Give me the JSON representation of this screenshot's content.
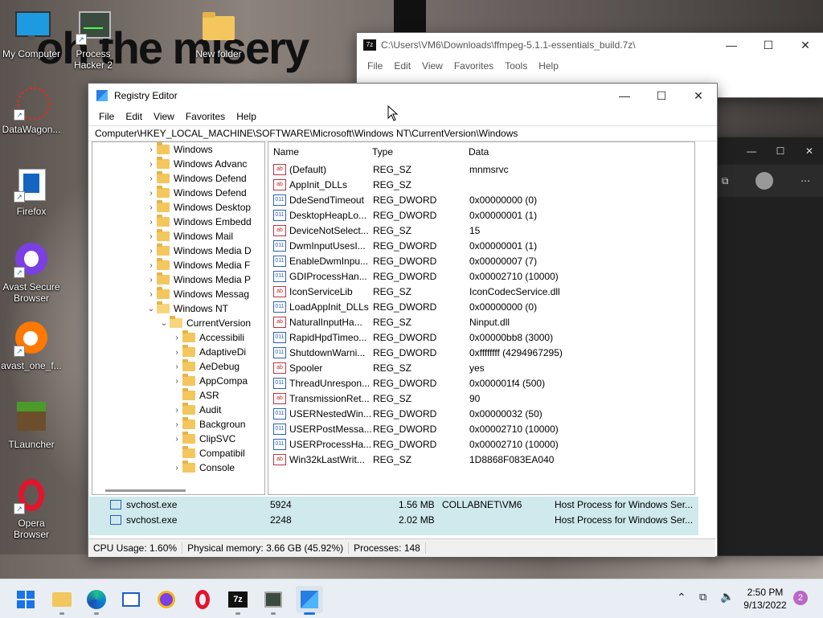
{
  "desktop": {
    "meme_text": "oh the misery",
    "icons": [
      {
        "label": "My Computer"
      },
      {
        "label": "Process\nHacker 2"
      },
      {
        "label": "New folder"
      },
      {
        "label": "DataWagon..."
      },
      {
        "label": "Firefox"
      },
      {
        "label": "Avast Secure\nBrowser"
      },
      {
        "label": "avast_one_f..."
      },
      {
        "label": "TLauncher"
      },
      {
        "label": "Opera\nBrowser"
      }
    ]
  },
  "sevenzip": {
    "title": "C:\\Users\\VM6\\Downloads\\ffmpeg-5.1.1-essentials_build.7z\\",
    "menu": [
      "File",
      "Edit",
      "View",
      "Favorites",
      "Tools",
      "Help"
    ]
  },
  "registry": {
    "title": "Registry Editor",
    "menu": [
      "File",
      "Edit",
      "View",
      "Favorites",
      "Help"
    ],
    "address": "Computer\\HKEY_LOCAL_MACHINE\\SOFTWARE\\Microsoft\\Windows NT\\CurrentVersion\\Windows",
    "tree": [
      {
        "label": "Windows",
        "depth": 0,
        "twist": "›"
      },
      {
        "label": "Windows Advanc",
        "depth": 0,
        "twist": "›"
      },
      {
        "label": "Windows Defend",
        "depth": 0,
        "twist": "›"
      },
      {
        "label": "Windows Defend",
        "depth": 0,
        "twist": "›"
      },
      {
        "label": "Windows Desktop",
        "depth": 0,
        "twist": "›"
      },
      {
        "label": "Windows Embedd",
        "depth": 0,
        "twist": "›"
      },
      {
        "label": "Windows Mail",
        "depth": 0,
        "twist": "›"
      },
      {
        "label": "Windows Media D",
        "depth": 0,
        "twist": "›"
      },
      {
        "label": "Windows Media F",
        "depth": 0,
        "twist": "›"
      },
      {
        "label": "Windows Media P",
        "depth": 0,
        "twist": "›"
      },
      {
        "label": "Windows Messag",
        "depth": 0,
        "twist": "›"
      },
      {
        "label": "Windows NT",
        "depth": 0,
        "twist": "⌄"
      },
      {
        "label": "CurrentVersion",
        "depth": 1,
        "twist": "⌄"
      },
      {
        "label": "Accessibili",
        "depth": 2,
        "twist": "›"
      },
      {
        "label": "AdaptiveDi",
        "depth": 2,
        "twist": "›"
      },
      {
        "label": "AeDebug",
        "depth": 2,
        "twist": "›"
      },
      {
        "label": "AppCompa",
        "depth": 2,
        "twist": "›"
      },
      {
        "label": "ASR",
        "depth": 2,
        "twist": ""
      },
      {
        "label": "Audit",
        "depth": 2,
        "twist": "›"
      },
      {
        "label": "Backgroun",
        "depth": 2,
        "twist": "›"
      },
      {
        "label": "ClipSVC",
        "depth": 2,
        "twist": "›"
      },
      {
        "label": "Compatibil",
        "depth": 2,
        "twist": ""
      },
      {
        "label": "Console",
        "depth": 2,
        "twist": "›"
      }
    ],
    "columns": {
      "name": "Name",
      "type": "Type",
      "data": "Data"
    },
    "values": [
      {
        "icon": "ab",
        "name": "(Default)",
        "type": "REG_SZ",
        "data": "mnmsrvc"
      },
      {
        "icon": "ab",
        "name": "AppInit_DLLs",
        "type": "REG_SZ",
        "data": ""
      },
      {
        "icon": "dw",
        "name": "DdeSendTimeout",
        "type": "REG_DWORD",
        "data": "0x00000000 (0)"
      },
      {
        "icon": "dw",
        "name": "DesktopHeapLo...",
        "type": "REG_DWORD",
        "data": "0x00000001 (1)"
      },
      {
        "icon": "ab",
        "name": "DeviceNotSelect...",
        "type": "REG_SZ",
        "data": "15"
      },
      {
        "icon": "dw",
        "name": "DwmInputUsesI...",
        "type": "REG_DWORD",
        "data": "0x00000001 (1)"
      },
      {
        "icon": "dw",
        "name": "EnableDwmInpu...",
        "type": "REG_DWORD",
        "data": "0x00000007 (7)"
      },
      {
        "icon": "dw",
        "name": "GDIProcessHan...",
        "type": "REG_DWORD",
        "data": "0x00002710 (10000)"
      },
      {
        "icon": "ab",
        "name": "IconServiceLib",
        "type": "REG_SZ",
        "data": "IconCodecService.dll"
      },
      {
        "icon": "dw",
        "name": "LoadAppInit_DLLs",
        "type": "REG_DWORD",
        "data": "0x00000000 (0)"
      },
      {
        "icon": "ab",
        "name": "NaturalInputHa...",
        "type": "REG_SZ",
        "data": "Ninput.dll"
      },
      {
        "icon": "dw",
        "name": "RapidHpdTimeo...",
        "type": "REG_DWORD",
        "data": "0x00000bb8 (3000)"
      },
      {
        "icon": "dw",
        "name": "ShutdownWarni...",
        "type": "REG_DWORD",
        "data": "0xffffffff (4294967295)"
      },
      {
        "icon": "ab",
        "name": "Spooler",
        "type": "REG_SZ",
        "data": "yes"
      },
      {
        "icon": "dw",
        "name": "ThreadUnrespon...",
        "type": "REG_DWORD",
        "data": "0x000001f4 (500)"
      },
      {
        "icon": "ab",
        "name": "TransmissionRet...",
        "type": "REG_SZ",
        "data": "90"
      },
      {
        "icon": "dw",
        "name": "USERNestedWin...",
        "type": "REG_DWORD",
        "data": "0x00000032 (50)"
      },
      {
        "icon": "dw",
        "name": "USERPostMessa...",
        "type": "REG_DWORD",
        "data": "0x00002710 (10000)"
      },
      {
        "icon": "dw",
        "name": "USERProcessHa...",
        "type": "REG_DWORD",
        "data": "0x00002710 (10000)"
      },
      {
        "icon": "ab",
        "name": "Win32kLastWrit...",
        "type": "REG_SZ",
        "data": "1D8868F083EA040"
      }
    ]
  },
  "taskmanager_rows": [
    {
      "name": "svchost.exe",
      "pid": "5924",
      "mem": "1.56 MB",
      "user": "COLLABNET\\VM6",
      "desc": "Host Process for Windows Ser..."
    },
    {
      "name": "svchost.exe",
      "pid": "2248",
      "mem": "2.02 MB",
      "user": "",
      "desc": "Host Process for Windows Ser..."
    }
  ],
  "status": {
    "cpu": "CPU Usage: 1.60%",
    "memory": "Physical memory: 3.66 GB (45.92%)",
    "processes": "Processes: 148"
  },
  "clock": {
    "time": "2:50 PM",
    "date": "9/13/2022"
  },
  "notification_count": "2",
  "colors": {
    "accent": "#1a73e8",
    "folder": "#f3c65e",
    "tm_highlight": "#cfe9ec"
  }
}
